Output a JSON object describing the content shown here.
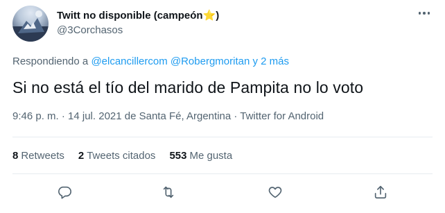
{
  "author": {
    "display_name": "Twitt no disponible (campeón",
    "badge_emoji": "⭐",
    "display_name_close": ")",
    "username": "@3Corchasos"
  },
  "reply": {
    "prefix": "Respondiendo a ",
    "mentions": [
      "@elcancillercom",
      "@Robergmoritan"
    ],
    "suffix": " y 2 más"
  },
  "tweet": {
    "text": "Si no está el tío del marido de Pampita no lo voto",
    "meta": "9:46 p. m. · 14 jul. 2021 de Santa Fé, Argentina · Twitter for Android"
  },
  "stats": {
    "retweets_count": "8",
    "retweets_label": "Retweets",
    "quotes_count": "2",
    "quotes_label": "Tweets citados",
    "likes_count": "553",
    "likes_label": "Me gusta"
  },
  "icons": {
    "more": "more-horizontal-icon",
    "reply": "reply-icon",
    "retweet": "retweet-icon",
    "like": "heart-icon",
    "share": "share-icon"
  },
  "colors": {
    "link": "#1d9bf0",
    "secondary_text": "#536471",
    "primary_text": "#0f1419",
    "divider": "#e6ecf0"
  }
}
